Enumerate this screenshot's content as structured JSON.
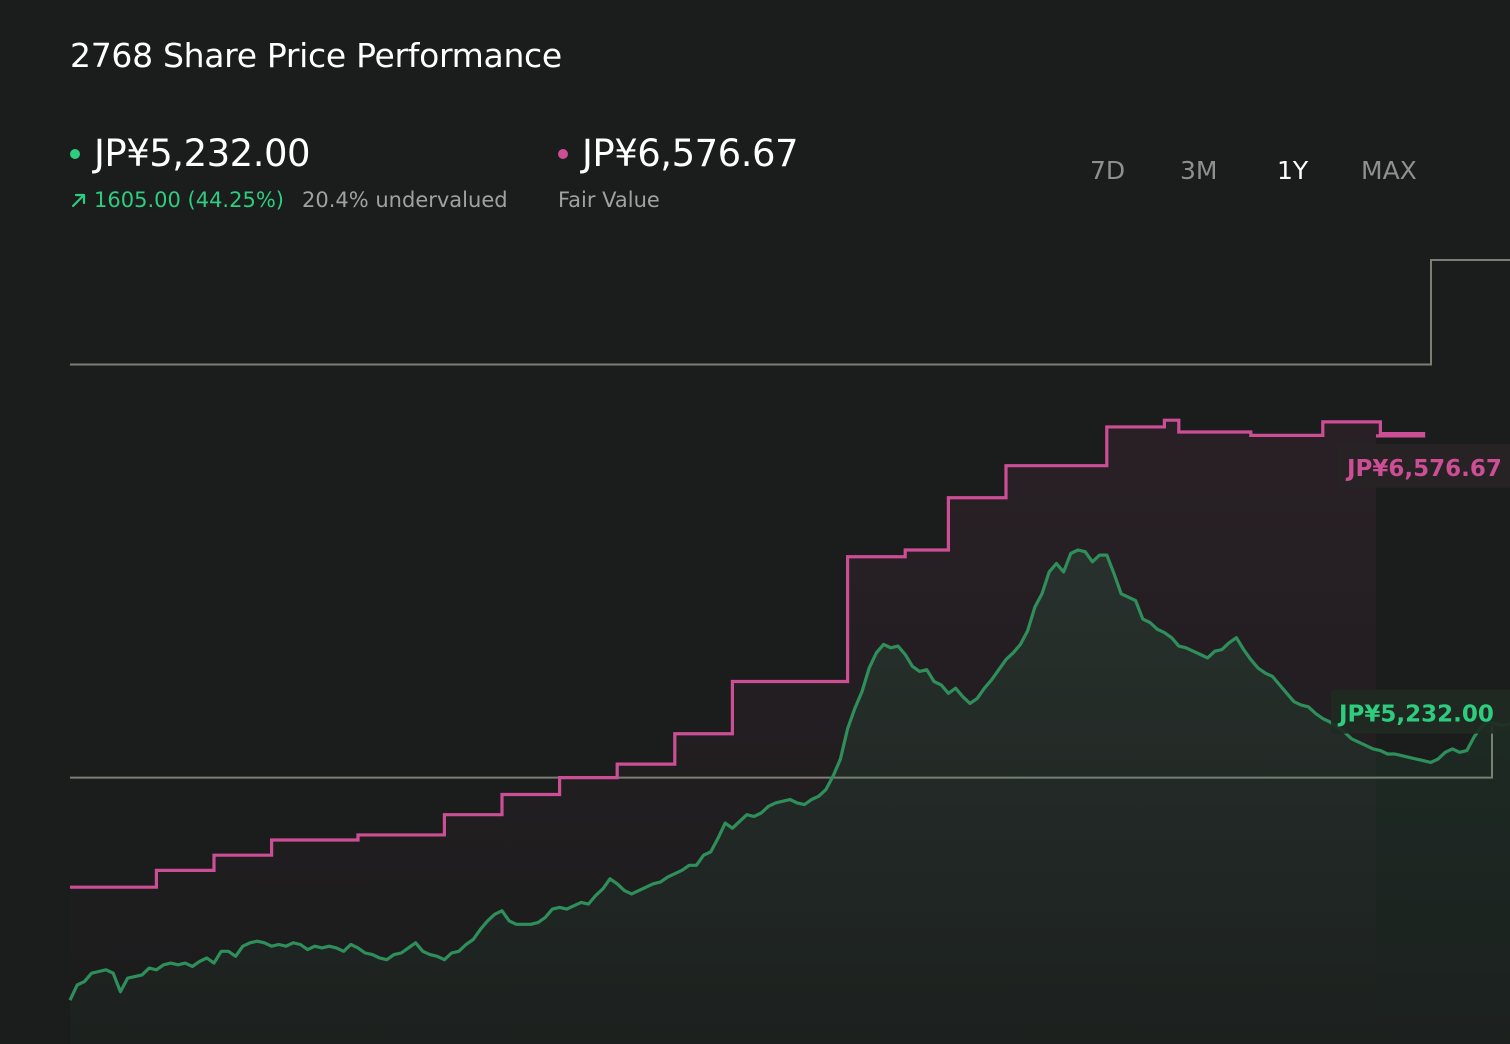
{
  "header": {
    "title": "2768 Share Price Performance"
  },
  "price": {
    "value": "JP¥5,232.00",
    "change": "1605.00 (44.25%)",
    "valuation_note": "20.4% undervalued",
    "dot_color": "#2ecc7f"
  },
  "fair_value": {
    "value": "JP¥6,576.67",
    "label": "Fair Value",
    "dot_color": "#cc4e95"
  },
  "range_tabs": [
    {
      "label": "7D",
      "active": false
    },
    {
      "label": "3M",
      "active": false
    },
    {
      "label": "1Y",
      "active": true
    },
    {
      "label": "MAX",
      "active": false
    }
  ],
  "chart_data": {
    "type": "line",
    "x_range": [
      0,
      100
    ],
    "ylim": [
      2970,
      7620
    ],
    "reference_lines": [
      {
        "value": 4550
      },
      {
        "value": 7000
      }
    ],
    "series": [
      {
        "color": "#2f8f5b",
        "end_label": "JP¥5,232.00",
        "points": [
          [
            0,
            3230
          ],
          [
            0.5,
            3320
          ],
          [
            1,
            3340
          ],
          [
            1.5,
            3390
          ],
          [
            2,
            3400
          ],
          [
            2.5,
            3410
          ],
          [
            3,
            3390
          ],
          [
            3.5,
            3280
          ],
          [
            4,
            3360
          ],
          [
            4.5,
            3370
          ],
          [
            5,
            3380
          ],
          [
            5.5,
            3420
          ],
          [
            6,
            3410
          ],
          [
            6.5,
            3440
          ],
          [
            7,
            3450
          ],
          [
            7.5,
            3440
          ],
          [
            8,
            3450
          ],
          [
            8.5,
            3430
          ],
          [
            9,
            3460
          ],
          [
            9.5,
            3480
          ],
          [
            10,
            3450
          ],
          [
            10.5,
            3520
          ],
          [
            11,
            3520
          ],
          [
            11.5,
            3490
          ],
          [
            12,
            3550
          ],
          [
            12.5,
            3570
          ],
          [
            13,
            3580
          ],
          [
            13.5,
            3570
          ],
          [
            14,
            3550
          ],
          [
            14.5,
            3560
          ],
          [
            15,
            3550
          ],
          [
            15.5,
            3570
          ],
          [
            16,
            3560
          ],
          [
            16.5,
            3530
          ],
          [
            17,
            3550
          ],
          [
            17.5,
            3540
          ],
          [
            18,
            3550
          ],
          [
            18.5,
            3540
          ],
          [
            19,
            3520
          ],
          [
            19.5,
            3560
          ],
          [
            20,
            3540
          ],
          [
            20.5,
            3510
          ],
          [
            21,
            3500
          ],
          [
            21.5,
            3480
          ],
          [
            22,
            3470
          ],
          [
            22.5,
            3500
          ],
          [
            23,
            3510
          ],
          [
            23.5,
            3540
          ],
          [
            24,
            3570
          ],
          [
            24.5,
            3520
          ],
          [
            25,
            3500
          ],
          [
            25.5,
            3490
          ],
          [
            26,
            3470
          ],
          [
            26.5,
            3510
          ],
          [
            27,
            3520
          ],
          [
            27.5,
            3560
          ],
          [
            28,
            3590
          ],
          [
            28.5,
            3650
          ],
          [
            29,
            3700
          ],
          [
            29.5,
            3740
          ],
          [
            30,
            3760
          ],
          [
            30.5,
            3700
          ],
          [
            31,
            3680
          ],
          [
            31.5,
            3680
          ],
          [
            32,
            3680
          ],
          [
            32.5,
            3690
          ],
          [
            33,
            3720
          ],
          [
            33.5,
            3770
          ],
          [
            34,
            3780
          ],
          [
            34.5,
            3770
          ],
          [
            35,
            3790
          ],
          [
            35.5,
            3810
          ],
          [
            36,
            3800
          ],
          [
            36.5,
            3850
          ],
          [
            37,
            3890
          ],
          [
            37.5,
            3950
          ],
          [
            38,
            3920
          ],
          [
            38.5,
            3880
          ],
          [
            39,
            3860
          ],
          [
            39.5,
            3880
          ],
          [
            40,
            3900
          ],
          [
            40.5,
            3920
          ],
          [
            41,
            3930
          ],
          [
            41.5,
            3960
          ],
          [
            42,
            3980
          ],
          [
            42.5,
            4000
          ],
          [
            43,
            4030
          ],
          [
            43.5,
            4030
          ],
          [
            44,
            4090
          ],
          [
            44.5,
            4110
          ],
          [
            45,
            4190
          ],
          [
            45.5,
            4280
          ],
          [
            46,
            4250
          ],
          [
            46.5,
            4290
          ],
          [
            47,
            4330
          ],
          [
            47.5,
            4320
          ],
          [
            48,
            4340
          ],
          [
            48.5,
            4380
          ],
          [
            49,
            4400
          ],
          [
            49.5,
            4410
          ],
          [
            50,
            4420
          ],
          [
            50.5,
            4400
          ],
          [
            51,
            4390
          ],
          [
            51.5,
            4420
          ],
          [
            52,
            4440
          ],
          [
            52.5,
            4480
          ],
          [
            53,
            4560
          ],
          [
            53.5,
            4660
          ],
          [
            54,
            4840
          ],
          [
            54.5,
            4960
          ],
          [
            55,
            5060
          ],
          [
            55.5,
            5200
          ],
          [
            56,
            5290
          ],
          [
            56.5,
            5340
          ],
          [
            57,
            5320
          ],
          [
            57.5,
            5330
          ],
          [
            58,
            5280
          ],
          [
            58.5,
            5210
          ],
          [
            59,
            5180
          ],
          [
            59.5,
            5190
          ],
          [
            60,
            5120
          ],
          [
            60.5,
            5100
          ],
          [
            61,
            5050
          ],
          [
            61.5,
            5080
          ],
          [
            62,
            5030
          ],
          [
            62.5,
            4990
          ],
          [
            63,
            5020
          ],
          [
            63.5,
            5080
          ],
          [
            64,
            5130
          ],
          [
            64.5,
            5190
          ],
          [
            65,
            5250
          ],
          [
            65.5,
            5290
          ],
          [
            66,
            5340
          ],
          [
            66.5,
            5420
          ],
          [
            67,
            5560
          ],
          [
            67.5,
            5640
          ],
          [
            68,
            5770
          ],
          [
            68.5,
            5820
          ],
          [
            69,
            5770
          ],
          [
            69.5,
            5880
          ],
          [
            70,
            5900
          ],
          [
            70.5,
            5890
          ],
          [
            71,
            5830
          ],
          [
            71.5,
            5870
          ],
          [
            72,
            5870
          ],
          [
            72.5,
            5760
          ],
          [
            73,
            5640
          ],
          [
            73.5,
            5620
          ],
          [
            74,
            5600
          ],
          [
            74.5,
            5490
          ],
          [
            75,
            5470
          ],
          [
            75.5,
            5430
          ],
          [
            76,
            5410
          ],
          [
            76.5,
            5380
          ],
          [
            77,
            5330
          ],
          [
            77.5,
            5320
          ],
          [
            78,
            5300
          ],
          [
            78.5,
            5280
          ],
          [
            79,
            5260
          ],
          [
            79.5,
            5300
          ],
          [
            80,
            5310
          ],
          [
            80.5,
            5350
          ],
          [
            81,
            5380
          ],
          [
            81.5,
            5310
          ],
          [
            82,
            5250
          ],
          [
            82.5,
            5200
          ],
          [
            83,
            5170
          ],
          [
            83.5,
            5150
          ],
          [
            84,
            5100
          ],
          [
            84.5,
            5050
          ],
          [
            85,
            5000
          ],
          [
            85.5,
            4980
          ],
          [
            86,
            4970
          ],
          [
            86.5,
            4930
          ],
          [
            87,
            4900
          ],
          [
            87.5,
            4880
          ],
          [
            88,
            4850
          ],
          [
            88.5,
            4820
          ],
          [
            89,
            4780
          ],
          [
            89.5,
            4760
          ],
          [
            90,
            4740
          ],
          [
            90.5,
            4720
          ],
          [
            91,
            4710
          ],
          [
            91.5,
            4690
          ],
          [
            92,
            4690
          ],
          [
            92.5,
            4680
          ],
          [
            93,
            4670
          ],
          [
            93.5,
            4660
          ],
          [
            94,
            4650
          ],
          [
            94.5,
            4640
          ],
          [
            95,
            4660
          ],
          [
            95.5,
            4700
          ],
          [
            96,
            4720
          ],
          [
            96.5,
            4700
          ],
          [
            97,
            4710
          ],
          [
            97.5,
            4790
          ],
          [
            98,
            4850
          ],
          [
            98.5,
            4880
          ],
          [
            99,
            4870
          ],
          [
            99.5,
            4860
          ],
          [
            100,
            4870
          ]
        ]
      },
      {
        "color": "#cc4e95",
        "end_label": "JP¥6,576.67",
        "step": true,
        "points": [
          [
            0,
            3900
          ],
          [
            6,
            4000
          ],
          [
            10,
            4090
          ],
          [
            14,
            4180
          ],
          [
            20,
            4210
          ],
          [
            26,
            4330
          ],
          [
            30,
            4450
          ],
          [
            34,
            4550
          ],
          [
            38,
            4630
          ],
          [
            42,
            4810
          ],
          [
            46,
            5120
          ],
          [
            54,
            5860
          ],
          [
            58,
            5900
          ],
          [
            61,
            6210
          ],
          [
            65,
            6400
          ],
          [
            72,
            6630
          ],
          [
            76,
            6670
          ],
          [
            77,
            6600
          ],
          [
            80,
            6600
          ],
          [
            82,
            6580
          ],
          [
            87,
            6660
          ],
          [
            91,
            6590
          ],
          [
            94,
            6576.67
          ]
        ]
      }
    ]
  }
}
